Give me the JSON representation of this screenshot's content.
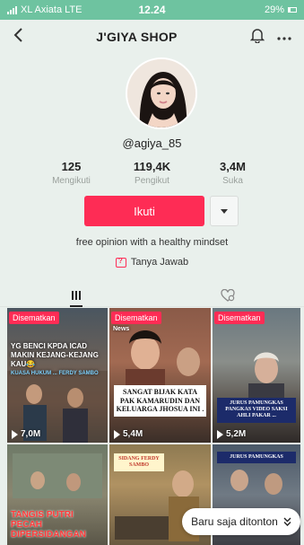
{
  "status_bar": {
    "carrier": "XL Axiata  LTE",
    "time": "12.24",
    "battery": "29%"
  },
  "header": {
    "title": "J'GIYA SHOP"
  },
  "profile": {
    "username": "@agiya_85",
    "stats": [
      {
        "value": "125",
        "label": "Mengikuti"
      },
      {
        "value": "119,4K",
        "label": "Pengikut"
      },
      {
        "value": "3,4M",
        "label": "Suka"
      }
    ],
    "follow_label": "Ikuti",
    "bio": "free opinion with a healthy mindset",
    "qa_label": "Tanya Jawab"
  },
  "tabs": [
    {
      "icon": "grid-icon",
      "active": true
    },
    {
      "icon": "liked-hidden-icon",
      "active": false
    }
  ],
  "videos": [
    {
      "pinned": "Disematkan",
      "views": "7,0M",
      "caption_top": "YG BENCI KPDA ICAD MAKIN KEJANG-KEJANG KAU😂",
      "caption_small": "KUASA HUKUM ... FERDY SAMBO"
    },
    {
      "pinned": "Disematkan",
      "views": "5,4M",
      "caption_top": "News",
      "caption_box": "SANGAT BIJAK KATA PAK KAMARUDIN DAN KELUARGA JHOSUA INI ."
    },
    {
      "pinned": "Disematkan",
      "views": "5,2M",
      "caption_box": "JURUS PAMUNGKAS PANGKAS VIDEO SAKSI AHLI PAKAR ..."
    },
    {
      "caption_red": "TANGIS PUTRI PECAH DIPERSIDANGAN"
    },
    {
      "caption_box": "SIDANG FERDY SAMBO"
    },
    {
      "caption_box": "JURUS PAMUNGKAS"
    }
  ],
  "recent_pill": {
    "label": "Baru saja ditonton"
  },
  "colors": {
    "accent": "#fe2c55",
    "status_bar": "#6ec3a0",
    "background": "#e9f0ec"
  }
}
